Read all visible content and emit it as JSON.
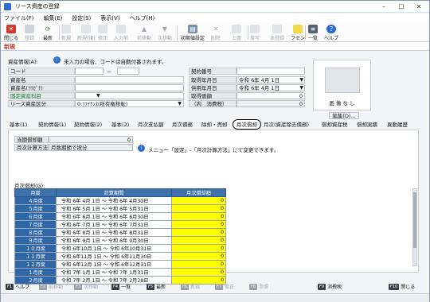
{
  "window": {
    "title": "リース資産の登録"
  },
  "menu": [
    "ファイル(F)",
    "編集(E)",
    "設定(S)",
    "表示(V)",
    "ヘルプ(H)"
  ],
  "toolbar": [
    {
      "label": "閉じる",
      "icon": "close-icon",
      "enabled": true
    },
    {
      "label": "登録",
      "icon": "save-icon",
      "enabled": false
    },
    {
      "label": "最新",
      "icon": "refresh-icon",
      "enabled": true
    },
    {
      "label": "新規",
      "icon": "new-icon",
      "enabled": false
    },
    {
      "label": "新規(複)",
      "icon": "copy-new-icon",
      "enabled": false
    },
    {
      "label": "修正",
      "icon": "edit-icon",
      "enabled": false
    },
    {
      "label": "入力前",
      "icon": "undo-icon",
      "enabled": false
    },
    {
      "label": "前移動",
      "icon": "arrow-up-icon",
      "enabled": false
    },
    {
      "label": "次移動",
      "icon": "arrow-down-icon",
      "enabled": false
    },
    {
      "label": "初期値設定",
      "icon": "settings-icon",
      "enabled": true
    },
    {
      "label": "削除",
      "icon": "delete-icon",
      "enabled": false
    },
    {
      "label": "上書",
      "icon": "overwrite-icon",
      "enabled": false
    },
    {
      "label": "一覧",
      "icon": "list-icon",
      "enabled": true
    },
    {
      "label": "フセン",
      "icon": "sticky-note-icon",
      "enabled": true
    },
    {
      "label": "ヘルプ",
      "icon": "help-icon",
      "enabled": true
    }
  ],
  "toolbar_extra": {
    "sort": "接写",
    "history": "本登録",
    "help": "ヘルプ"
  },
  "mode": "新規",
  "asset_info": {
    "header": "資産情報(A):",
    "notice": "未入力の場合、コードは自動付番されます。",
    "code_label": "コード",
    "code_sep": "－",
    "name_label": "資産名",
    "kana_label": "資産名(ﾌﾘｶﾞﾅ)",
    "fixed_label": "固定資産科目",
    "class_label": "リース資産区分",
    "class_value": "0:ﾌｧｲﾅﾝｽ(所有権移転)"
  },
  "contract": {
    "no_label": "契約番号",
    "acq_label": "取得年月日",
    "acq_value": "令和  6年  4月  1日",
    "use_label": "供用年月日",
    "use_value": "令和  6年  4月  1日",
    "price_label": "取得価額",
    "price_value": "0",
    "tax_label": "（内　消費税）",
    "tax_value": "0"
  },
  "image": {
    "label": "画 像 な し",
    "edit_button": "編集(D)..."
  },
  "tabs": [
    "基本(1)",
    "契約情報(1)",
    "契約情報(2)",
    "基本(2)",
    "月次支払額",
    "月次債務",
    "除却・売却",
    "月次償却",
    "月次(資産除去債務)",
    "償却資産税",
    "償却実績",
    "異動履歴"
  ],
  "active_tab": "月次償却",
  "monthly": {
    "accum_label": "当期償却額",
    "accum_value": "0",
    "method_label": "月次計算方法",
    "method_value": "月数期間で按分",
    "info": "メニュー「設定」-「月次計算方法」にて変更できます。",
    "grid_label": "月次償却(G):",
    "columns": [
      "月度",
      "計算期間",
      "月次償却額"
    ],
    "rows": [
      {
        "m": "４月度",
        "p": "令和 6年 4月 1日 ～ 令和 6年 4月30日",
        "v": "0"
      },
      {
        "m": "５月度",
        "p": "令和 6年 5月 1日 ～ 令和 6年 5月31日",
        "v": "0"
      },
      {
        "m": "６月度",
        "p": "令和 6年 6月 1日 ～ 令和 6年 6月30日",
        "v": "0"
      },
      {
        "m": "７月度",
        "p": "令和 6年 7月 1日 ～ 令和 6年 7月31日",
        "v": "0"
      },
      {
        "m": "８月度",
        "p": "令和 6年 8月 1日 ～ 令和 6年 8月31日",
        "v": "0"
      },
      {
        "m": "９月度",
        "p": "令和 6年 9月 1日 ～ 令和 6年 9月30日",
        "v": "0"
      },
      {
        "m": "１０月度",
        "p": "令和 6年10月 1日 ～ 令和 6年10月31日",
        "v": "0"
      },
      {
        "m": "１１月度",
        "p": "令和 6年11月 1日 ～ 令和 6年11月30日",
        "v": "0"
      },
      {
        "m": "１２月度",
        "p": "令和 6年12月 1日 ～ 令和 6年12月31日",
        "v": "0"
      },
      {
        "m": "１月度",
        "p": "令和 7年 1月 1日 ～ 令和 7年 1月31日",
        "v": "0"
      },
      {
        "m": "２月度",
        "p": "令和 7年 2月 1日 ～ 令和 7年 2月28日",
        "v": "0"
      }
    ]
  },
  "fkeys": [
    {
      "k": "F1",
      "label": "ヘルプ",
      "enabled": true
    },
    {
      "k": "F2",
      "label": "前移動",
      "enabled": false
    },
    {
      "k": "F3",
      "label": "次移動",
      "enabled": false
    },
    {
      "k": "F4",
      "label": "一覧",
      "enabled": true
    },
    {
      "k": "F5",
      "label": "最新",
      "enabled": true
    },
    {
      "k": "F6",
      "label": "新規",
      "enabled": false
    },
    {
      "k": "F7",
      "label": "修正",
      "enabled": false
    },
    {
      "k": "F8",
      "label": "参照",
      "enabled": false
    },
    {
      "k": "F9",
      "label": "消費税",
      "enabled": true
    },
    {
      "k": "F10",
      "label": "閉じる",
      "enabled": true
    }
  ]
}
